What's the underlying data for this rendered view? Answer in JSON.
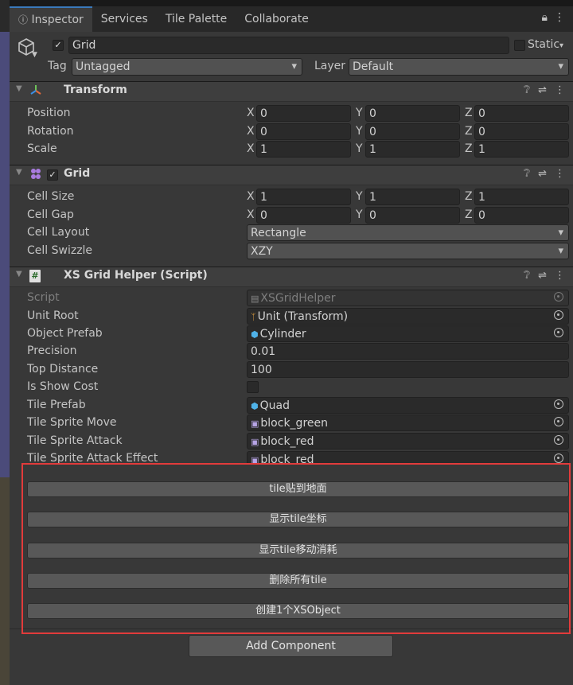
{
  "colors": {
    "accent_tab": "#3a79bb",
    "highlight_box": "#e23b3b",
    "panel_bg": "#383838",
    "field_bg": "#2a2a2a"
  },
  "tabs": [
    {
      "label": "Inspector",
      "icon": "info-icon",
      "active": true
    },
    {
      "label": "Services",
      "active": false
    },
    {
      "label": "Tile Palette",
      "active": false
    },
    {
      "label": "Collaborate",
      "active": false
    }
  ],
  "object": {
    "name": "Grid",
    "active": true,
    "static_label": "Static",
    "tag_label": "Tag",
    "tag_value": "Untagged",
    "layer_label": "Layer",
    "layer_value": "Default"
  },
  "transform": {
    "title": "Transform",
    "rows": [
      {
        "label": "Position",
        "x": "0",
        "y": "0",
        "z": "0"
      },
      {
        "label": "Rotation",
        "x": "0",
        "y": "0",
        "z": "0"
      },
      {
        "label": "Scale",
        "x": "1",
        "y": "1",
        "z": "1"
      }
    ]
  },
  "grid": {
    "title": "Grid",
    "enabled": true,
    "cell_size": {
      "label": "Cell Size",
      "x": "1",
      "y": "1",
      "z": "1"
    },
    "cell_gap": {
      "label": "Cell Gap",
      "x": "0",
      "y": "0",
      "z": "0"
    },
    "cell_layout": {
      "label": "Cell Layout",
      "value": "Rectangle"
    },
    "cell_swizzle": {
      "label": "Cell Swizzle",
      "value": "XZY"
    }
  },
  "axes": {
    "x": "X",
    "y": "Y",
    "z": "Z"
  },
  "script": {
    "title": "XS Grid Helper (Script)",
    "script_label": "Script",
    "script_value": "XSGridHelper",
    "unit_root_label": "Unit Root",
    "unit_root_value": "Unit (Transform)",
    "object_prefab_label": "Object Prefab",
    "object_prefab_value": "Cylinder",
    "precision_label": "Precision",
    "precision_value": "0.01",
    "top_distance_label": "Top Distance",
    "top_distance_value": "100",
    "is_show_cost_label": "Is Show Cost",
    "is_show_cost_checked": false,
    "tile_prefab_label": "Tile Prefab",
    "tile_prefab_value": "Quad",
    "tile_sprite_move_label": "Tile Sprite Move",
    "tile_sprite_move_value": "block_green",
    "tile_sprite_attack_label": "Tile Sprite Attack",
    "tile_sprite_attack_value": "block_red",
    "tile_sprite_attack_effect_label": "Tile Sprite Attack Effect",
    "tile_sprite_attack_effect_value": "block_red"
  },
  "buttons": [
    "tile贴到地面",
    "显示tile坐标",
    "显示tile移动消耗",
    "删除所有tile",
    "创建1个XSObject"
  ],
  "add_component_label": "Add Component"
}
